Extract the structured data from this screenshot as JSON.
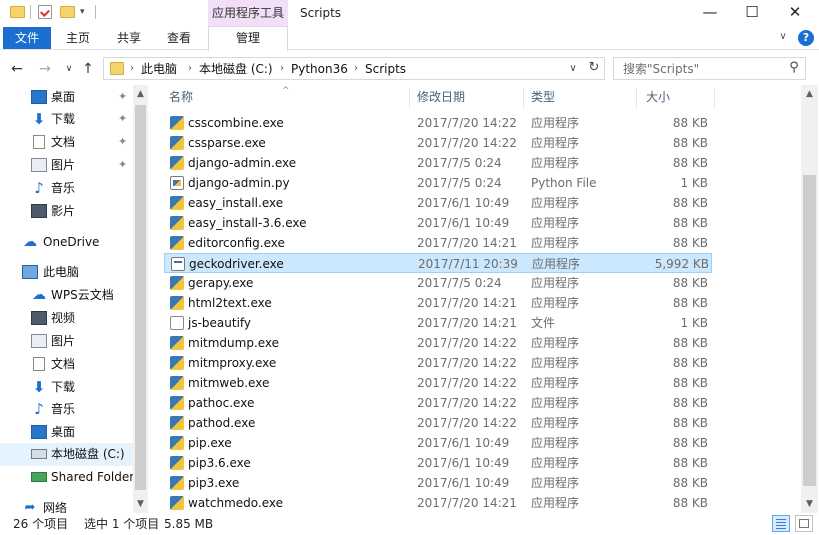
{
  "window": {
    "context_tab": "应用程序工具",
    "title": "Scripts",
    "minimize_glyph": "—",
    "maximize_glyph": "☐",
    "close_glyph": "✕"
  },
  "ribbon": {
    "file_tab": "文件",
    "tabs": [
      "主页",
      "共享",
      "查看"
    ],
    "manage_tab": "管理",
    "chevron_glyph": "∨",
    "help_glyph": "?"
  },
  "nav": {
    "back_glyph": "←",
    "forward_glyph": "→",
    "recent_glyph": "∨",
    "up_glyph": "↑",
    "breadcrumbs": [
      "此电脑",
      "本地磁盘 (C:)",
      "Python36",
      "Scripts"
    ],
    "crumb_sep": "›",
    "dropdown_glyph": "∨",
    "refresh_glyph": "↻",
    "search_placeholder": "搜索\"Scripts\"",
    "search_glyph": "⚲"
  },
  "sidebar": {
    "pin_glyph": "✦",
    "items": [
      {
        "label": "桌面",
        "icon": "desktop-icon",
        "pinned": true
      },
      {
        "label": "下载",
        "icon": "download-icon",
        "pinned": true,
        "glyph": "⬇"
      },
      {
        "label": "文档",
        "icon": "document-icon",
        "pinned": true
      },
      {
        "label": "图片",
        "icon": "picture-icon",
        "pinned": true
      },
      {
        "label": "音乐",
        "icon": "music-icon",
        "pinned": false,
        "glyph": "♪"
      },
      {
        "label": "影片",
        "icon": "video-icon",
        "pinned": false
      },
      {
        "label": "OneDrive",
        "icon": "onedrive-icon",
        "pinned": false,
        "glyph": "☁"
      },
      {
        "label": "此电脑",
        "icon": "this-pc-icon",
        "pinned": false
      },
      {
        "label": "WPS云文档",
        "icon": "wps-cloud-icon",
        "pinned": false,
        "glyph": "☁"
      },
      {
        "label": "视频",
        "icon": "video-icon",
        "pinned": false
      },
      {
        "label": "图片",
        "icon": "picture-icon",
        "pinned": false
      },
      {
        "label": "文档",
        "icon": "document-icon",
        "pinned": false
      },
      {
        "label": "下载",
        "icon": "download-icon",
        "pinned": false,
        "glyph": "⬇"
      },
      {
        "label": "音乐",
        "icon": "music-icon",
        "pinned": false,
        "glyph": "♪"
      },
      {
        "label": "桌面",
        "icon": "desktop-icon",
        "pinned": false
      },
      {
        "label": "本地磁盘 (C:)",
        "icon": "local-disk-icon",
        "pinned": false,
        "selected": true
      },
      {
        "label": "Shared Folders",
        "icon": "shared-folders-icon",
        "pinned": false
      },
      {
        "label": "网络",
        "icon": "network-icon",
        "pinned": false,
        "glyph": "➦"
      }
    ]
  },
  "columns": {
    "name": "名称",
    "date": "修改日期",
    "type": "类型",
    "size": "大小"
  },
  "sort_glyph": "^",
  "files": [
    {
      "name": "csscombine.exe",
      "date": "2017/7/20 14:22",
      "type": "应用程序",
      "size": "88 KB",
      "icon": "exe"
    },
    {
      "name": "cssparse.exe",
      "date": "2017/7/20 14:22",
      "type": "应用程序",
      "size": "88 KB",
      "icon": "exe"
    },
    {
      "name": "django-admin.exe",
      "date": "2017/7/5 0:24",
      "type": "应用程序",
      "size": "88 KB",
      "icon": "exe"
    },
    {
      "name": "django-admin.py",
      "date": "2017/7/5 0:24",
      "type": "Python File",
      "size": "1 KB",
      "icon": "py"
    },
    {
      "name": "easy_install.exe",
      "date": "2017/6/1 10:49",
      "type": "应用程序",
      "size": "88 KB",
      "icon": "exe"
    },
    {
      "name": "easy_install-3.6.exe",
      "date": "2017/6/1 10:49",
      "type": "应用程序",
      "size": "88 KB",
      "icon": "exe"
    },
    {
      "name": "editorconfig.exe",
      "date": "2017/7/20 14:21",
      "type": "应用程序",
      "size": "88 KB",
      "icon": "exe"
    },
    {
      "name": "geckodriver.exe",
      "date": "2017/7/11 20:39",
      "type": "应用程序",
      "size": "5,992 KB",
      "icon": "gecko",
      "selected": true
    },
    {
      "name": "gerapy.exe",
      "date": "2017/7/5 0:24",
      "type": "应用程序",
      "size": "88 KB",
      "icon": "exe"
    },
    {
      "name": "html2text.exe",
      "date": "2017/7/20 14:21",
      "type": "应用程序",
      "size": "88 KB",
      "icon": "exe"
    },
    {
      "name": "js-beautify",
      "date": "2017/7/20 14:21",
      "type": "文件",
      "size": "1 KB",
      "icon": "generic"
    },
    {
      "name": "mitmdump.exe",
      "date": "2017/7/20 14:22",
      "type": "应用程序",
      "size": "88 KB",
      "icon": "exe"
    },
    {
      "name": "mitmproxy.exe",
      "date": "2017/7/20 14:22",
      "type": "应用程序",
      "size": "88 KB",
      "icon": "exe"
    },
    {
      "name": "mitmweb.exe",
      "date": "2017/7/20 14:22",
      "type": "应用程序",
      "size": "88 KB",
      "icon": "exe"
    },
    {
      "name": "pathoc.exe",
      "date": "2017/7/20 14:22",
      "type": "应用程序",
      "size": "88 KB",
      "icon": "exe"
    },
    {
      "name": "pathod.exe",
      "date": "2017/7/20 14:22",
      "type": "应用程序",
      "size": "88 KB",
      "icon": "exe"
    },
    {
      "name": "pip.exe",
      "date": "2017/6/1 10:49",
      "type": "应用程序",
      "size": "88 KB",
      "icon": "exe"
    },
    {
      "name": "pip3.6.exe",
      "date": "2017/6/1 10:49",
      "type": "应用程序",
      "size": "88 KB",
      "icon": "exe"
    },
    {
      "name": "pip3.exe",
      "date": "2017/6/1 10:49",
      "type": "应用程序",
      "size": "88 KB",
      "icon": "exe"
    },
    {
      "name": "watchmedo.exe",
      "date": "2017/7/20 14:21",
      "type": "应用程序",
      "size": "88 KB",
      "icon": "exe"
    }
  ],
  "scroll": {
    "up_glyph": "▲",
    "down_glyph": "▼"
  },
  "status": {
    "item_count": "26 个项目",
    "selection": "选中 1 个项目",
    "selection_size": "5.85 MB"
  },
  "colors": {
    "accent": "#1a6fd0",
    "context_tab_bg": "#f3def7",
    "selected_row": "#cce8ff",
    "sidebar_selected": "#e5f3ff"
  }
}
